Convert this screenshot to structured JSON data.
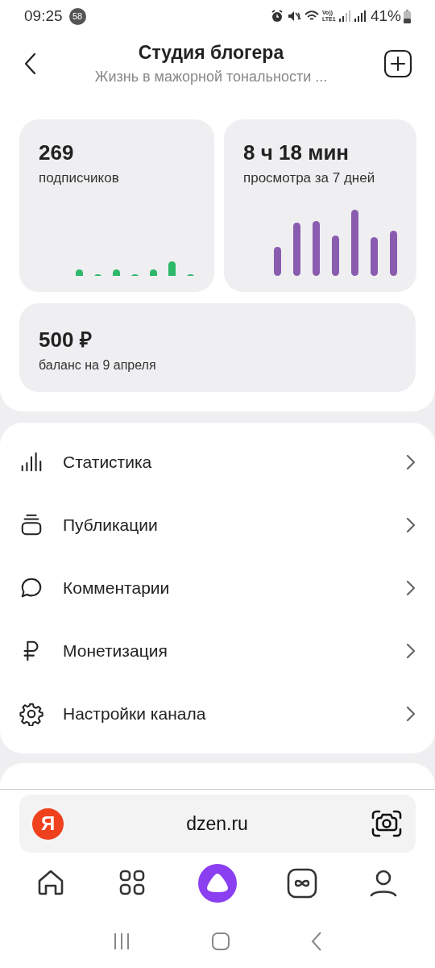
{
  "status_bar": {
    "time": "09:25",
    "notification_count": "58",
    "network": "Vo)) LTE1",
    "battery": "41%"
  },
  "header": {
    "title": "Студия блогера",
    "subtitle": "Жизнь в мажорной тональности ..."
  },
  "stats": [
    {
      "kind": "subscribers",
      "value": "269",
      "label": "подписчиков"
    },
    {
      "kind": "views",
      "value": "8 ч 18 мин",
      "label": "просмотра за 7 дней"
    }
  ],
  "balance": {
    "value": "500 ₽",
    "label": "баланс на 9 апреля"
  },
  "menu": [
    {
      "kind": "stats",
      "label": "Статистика"
    },
    {
      "kind": "publications",
      "label": "Публикации"
    },
    {
      "kind": "comments",
      "label": "Комментарии"
    },
    {
      "kind": "money",
      "label": "Монетизация"
    },
    {
      "kind": "settings",
      "label": "Настройки канала"
    }
  ],
  "address_bar": {
    "logo": "Я",
    "url": "dzen.ru"
  },
  "bottom_nav": [
    {
      "kind": "home"
    },
    {
      "kind": "apps"
    },
    {
      "kind": "assistant"
    },
    {
      "kind": "loop"
    },
    {
      "kind": "profile"
    }
  ]
}
